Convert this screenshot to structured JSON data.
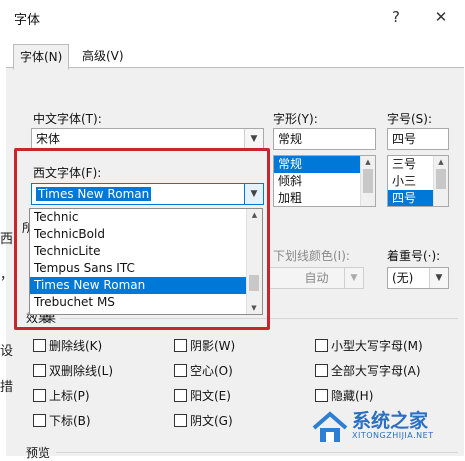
{
  "dialog": {
    "title": "字体",
    "help_label": "?",
    "close_label": "✕"
  },
  "tabs": [
    {
      "label": "字体(N)"
    },
    {
      "label": "高级(V)"
    }
  ],
  "chinese_font": {
    "label": "中文字体(T):",
    "value": "宋体"
  },
  "style": {
    "label": "字形(Y):",
    "value": "常规",
    "options": [
      "常规",
      "倾斜",
      "加粗"
    ]
  },
  "size": {
    "label": "字号(S):",
    "value": "四号",
    "options": [
      "三号",
      "小三",
      "四号"
    ]
  },
  "western_font": {
    "label": "西文字体(F):",
    "value": "Times New Roman",
    "options": [
      "Technic",
      "TechnicBold",
      "TechnicLite",
      "Tempus Sans ITC",
      "Times New Roman",
      "Trebuchet MS"
    ]
  },
  "underline_color": {
    "label": "下划线颜色(I):",
    "value": "自动"
  },
  "emphasis": {
    "label": "着重号(·):",
    "value": "(无)"
  },
  "effects": {
    "label": "效果",
    "items": [
      {
        "label": "删除线(K)"
      },
      {
        "label": "阴影(W)"
      },
      {
        "label": "小型大写字母(M)"
      },
      {
        "label": "双删除线(L)"
      },
      {
        "label": "空心(O)"
      },
      {
        "label": "全部大写字母(A)"
      },
      {
        "label": "上标(P)"
      },
      {
        "label": "阳文(E)"
      },
      {
        "label": "隐藏(H)"
      },
      {
        "label": "下标(B)"
      },
      {
        "label": "阴文(G)"
      }
    ]
  },
  "preview_label": "预览",
  "partial_labels": {
    "left_a": "所",
    "right_b": "果"
  },
  "background_text": [
    "西",
    "，",
    "设",
    "措"
  ],
  "watermark": {
    "name": "系统之家",
    "url": "XITONGZHIJIA.NET"
  },
  "colors": {
    "accent": "#0078d7",
    "highlight_box": "#c8262c"
  }
}
